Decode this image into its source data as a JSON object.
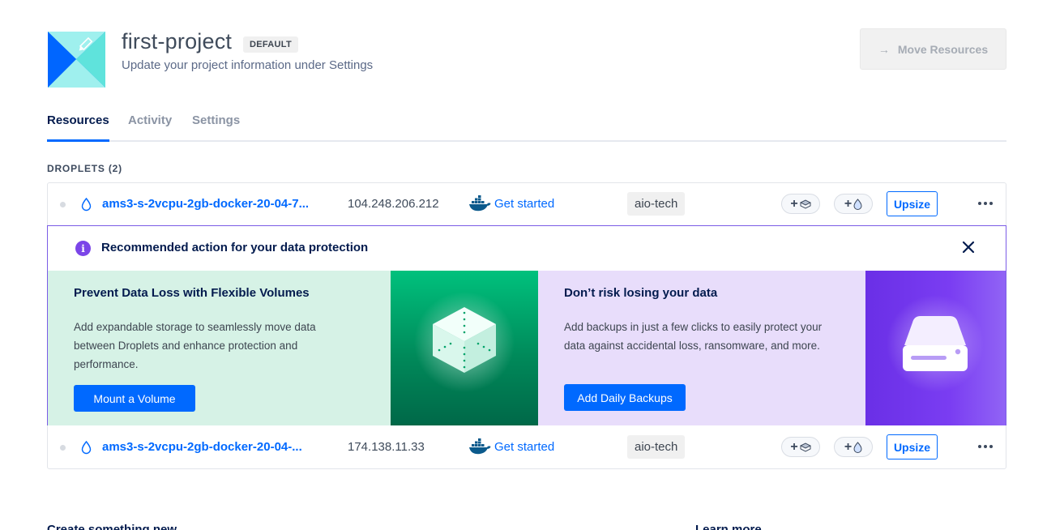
{
  "project": {
    "title": "first-project",
    "badge": "DEFAULT",
    "subtitle": "Update your project information under Settings",
    "move_button": "Move Resources"
  },
  "tabs": [
    {
      "label": "Resources",
      "active": true
    },
    {
      "label": "Activity",
      "active": false
    },
    {
      "label": "Settings",
      "active": false
    }
  ],
  "section_label": "DROPLETS (2)",
  "droplets": [
    {
      "name": "ams3-s-2vcpu-2gb-docker-20-04-7...",
      "ip": "104.248.206.212",
      "get_started": "Get started",
      "tag": "aio-tech",
      "upsize": "Upsize"
    },
    {
      "name": "ams3-s-2vcpu-2gb-docker-20-04-...",
      "ip": "174.138.11.33",
      "get_started": "Get started",
      "tag": "aio-tech",
      "upsize": "Upsize"
    }
  ],
  "recommendation": {
    "title": "Recommended action for your data protection",
    "volumes": {
      "title": "Prevent Data Loss with Flexible Volumes",
      "text": "Add expandable storage to seamlessly move data between Droplets and enhance protection and performance.",
      "button": "Mount a Volume"
    },
    "backups": {
      "title": "Don’t risk losing your data",
      "text": "Add backups in just a few clicks to easily protect your data against accidental loss, ransomware, and more.",
      "button": "Add Daily Backups"
    }
  },
  "footer": {
    "create": "Create something new",
    "learn": "Learn more"
  },
  "colors": {
    "accent": "#0069ff",
    "purple": "#7b45e8",
    "green_bg": "#d6f2e6",
    "purple_bg": "#e8ddfb"
  }
}
